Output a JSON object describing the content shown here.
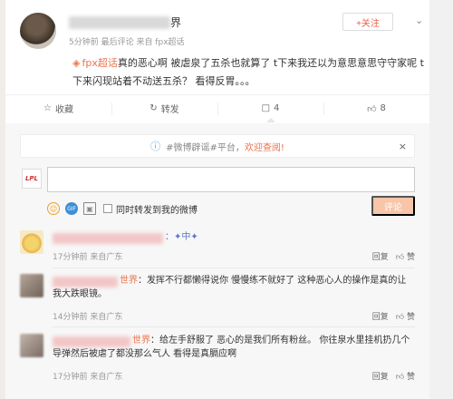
{
  "post": {
    "author_suffix": "界",
    "meta": "5分钟前 最后评论 来自 fpx超话",
    "follow_label": "+关注",
    "tag": "fpx超话",
    "body": "真的恶心啊 被虐泉了五杀也就算了 t下来我还以为意思意思守守家呢 t下来闪现站着不动送五杀？ 看得反胃。。。"
  },
  "actions": {
    "fav": "收藏",
    "repost": "转发",
    "comment_count": "4",
    "like_count": "8"
  },
  "notice": {
    "prefix": "#微博辟谣#平台，",
    "highlight": "欢迎查阅!"
  },
  "composer": {
    "avatar_text": "LPL",
    "sync_label": "同时转发到我的微博",
    "submit_label": "评论"
  },
  "comments": [
    {
      "name": "",
      "text": "：✦中✦",
      "meta": "17分钟前 来自广东",
      "reply": "回复",
      "like": "赞"
    },
    {
      "name": "世界",
      "text": "：发挥不行都懒得说你 慢慢练不就好了 这种恶心人的操作是真的让我大跌眼镜。",
      "meta": "14分钟前 来自广东",
      "reply": "回复",
      "like": "赞"
    },
    {
      "name": "世界",
      "text": "：给左手舒服了 恶心的是我们所有粉丝。 你往泉水里挂机扔几个导弹然后被虐了都没那么气人 看得是真膈应啊",
      "meta": "17分钟前 来自广东",
      "reply": "回复",
      "like": "赞"
    }
  ]
}
